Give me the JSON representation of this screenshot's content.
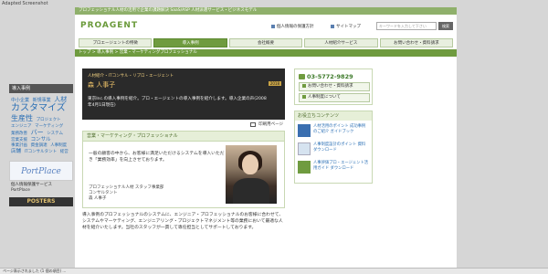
{
  "browser": {
    "title": "Adapted Screenshot",
    "status": "ページ表示されました (1 個の項目) ..."
  },
  "top_band": "プロフェッショナル人材の活用で企業の課題解決 SaaS/ASP 人材派遣サービス・ビジネスモデル",
  "header": {
    "logo": "PROAGENT",
    "link1": "個人情報の保護方針",
    "link2": "サイトマップ",
    "search_placeholder": "キーワードを入力して下さい",
    "search_button": "検索"
  },
  "nav": [
    {
      "label": "プロエージェントの特徴",
      "active": false
    },
    {
      "label": "導入事例",
      "active": true
    },
    {
      "label": "会社概要",
      "active": false
    },
    {
      "label": "人材紹介サービス",
      "active": false
    },
    {
      "label": "お問い合わせ・資料請求",
      "active": false
    }
  ],
  "breadcrumb": "トップ > 導入事例 > 営業・マーケティングプロフェッショナル",
  "sidebar": {
    "title": "導入事例",
    "cloud": [
      "中小企業",
      "新規事業",
      "人材",
      "カスタマイズ",
      "生産性",
      "プロジェクト",
      "エンジニア",
      "マーケティング",
      "業務改善",
      "バー",
      "システム",
      "営業支援",
      "コンサル",
      "事業計画",
      "資金調達",
      "人事制度",
      "店舗",
      "ITコンサルタント",
      "経営"
    ],
    "portplace": "PortPlace",
    "portplace_caption": "個人情報保護サービス PortPlace",
    "dark_banner": "POSTERS"
  },
  "hero": {
    "category": "人材紹介・ITコンサル・リプロ・エージェント",
    "name": "森 人事子",
    "number": "2018",
    "text": "東京Inc.の導入事例を紹介。プロ・エージェントの導入事例を紹介します。導入企業の声(2008年4月1日現在)"
  },
  "tools": {
    "print": "印刷用ページ",
    "print_icon": "printer-icon"
  },
  "section": {
    "title": "営業・マーケティング・プロフェッショナル",
    "intro": "一般の顧客の中から、お客様に満足いただけるシステムを導入いただき「業務効率」を向上させております。",
    "meta_line1": "プロフェッショナル人材 スタッフ事業部",
    "meta_line2": "コンサルタント",
    "meta_line3": "森 人事子"
  },
  "body_text": "導入事例のプロフェッショナルのシステムに、エンジニア・プロフェッショナルのお客様に合わせて、システムやマーケティング、エンジニアリング・プロジェクトマネジメント等の業務において最適な人材を紹介いたします。当社のスタッフが一貫して専任担当としてサポートしております。",
  "right": {
    "phone": "03-5772-9829",
    "btn1": "お問い合わせ・資料請求",
    "btn2": "人事制度について",
    "section_title": "お役立ちコンテンツ",
    "items": [
      {
        "text": "人材活用のポイント 成功事例のご紹介 ガイドブック"
      },
      {
        "text": "人事制度設計のポイント 資料ダウンロード"
      },
      {
        "text": "人事評価プロ・エージェント活用ガイド ダウンロード"
      }
    ]
  },
  "colors": {
    "accent_green": "#6f9b3f",
    "dark": "#2a2a2a",
    "link_blue": "#2a6fb5"
  }
}
